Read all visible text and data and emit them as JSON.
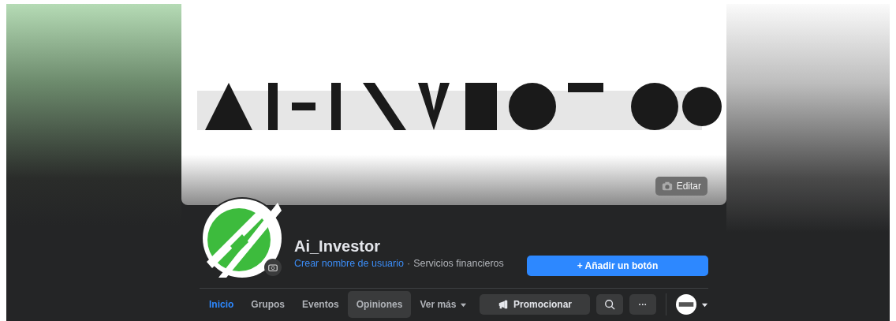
{
  "cover": {
    "edit_button": "Editar"
  },
  "profile": {
    "name": "Ai_Investor",
    "username_link": "Crear nombre de usuario",
    "separator": "·",
    "category": "Servicios financieros",
    "add_button": "+ Añadir un botón"
  },
  "tabs": [
    {
      "label": "Inicio",
      "selected": true,
      "hovered": false,
      "kind": "link"
    },
    {
      "label": "Grupos",
      "selected": false,
      "hovered": false,
      "kind": "link"
    },
    {
      "label": "Eventos",
      "selected": false,
      "hovered": false,
      "kind": "link"
    },
    {
      "label": "Opiniones",
      "selected": false,
      "hovered": true,
      "kind": "link"
    },
    {
      "label": "Ver más",
      "selected": false,
      "hovered": false,
      "kind": "dropdown"
    }
  ],
  "actions": {
    "promote_button": "Promocionar",
    "more_button": "···"
  }
}
